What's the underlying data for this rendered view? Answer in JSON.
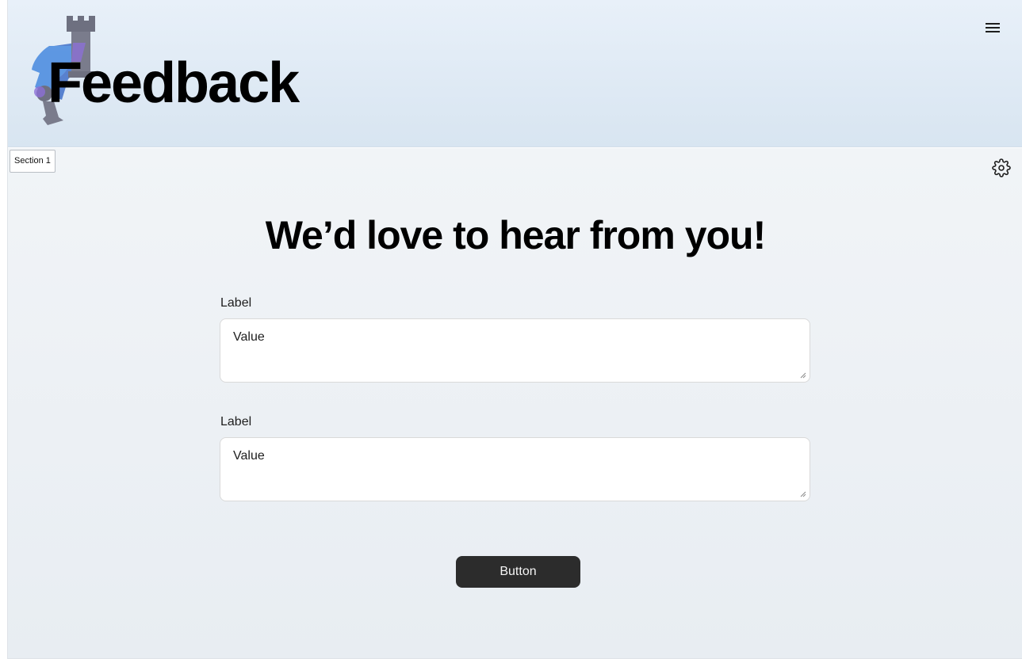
{
  "header": {
    "title": "Feedback",
    "logo_icon": "chess-pieces-logo-icon",
    "menu_icon": "hamburger-menu-icon",
    "background_color": "#e3ecf6"
  },
  "section": {
    "tag_label": "Section 1",
    "settings_icon": "gear-icon",
    "headline": "We’d love to hear from you!"
  },
  "form": {
    "fields": [
      {
        "label": "Label",
        "value": "Value"
      },
      {
        "label": "Label",
        "value": "Value"
      }
    ],
    "submit_label": "Button",
    "submit_color": "#2c2c2c"
  }
}
